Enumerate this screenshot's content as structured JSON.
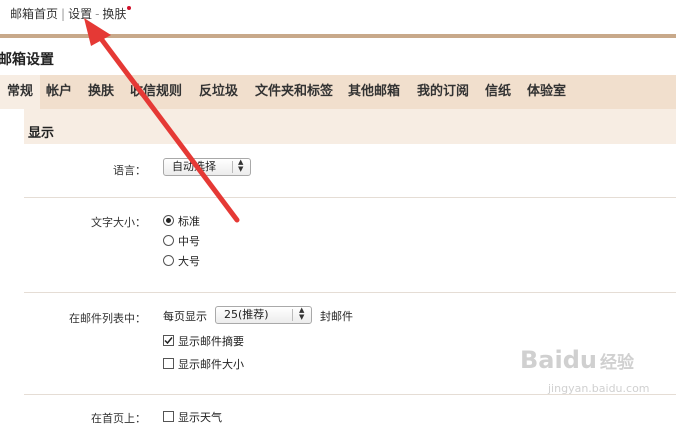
{
  "topnav": {
    "home": "邮箱首页",
    "sep": "|",
    "settings": "设置",
    "dash": "-",
    "skin": "换肤"
  },
  "page_title": "邮箱设置",
  "tabs": [
    {
      "label": "常规",
      "active": true
    },
    {
      "label": "帐户"
    },
    {
      "label": "换肤"
    },
    {
      "label": "收信规则"
    },
    {
      "label": "反垃圾"
    },
    {
      "label": "文件夹和标签"
    },
    {
      "label": "其他邮箱"
    },
    {
      "label": "我的订阅"
    },
    {
      "label": "信纸"
    },
    {
      "label": "体验室"
    }
  ],
  "section_title": "显示",
  "language": {
    "label": "语言：",
    "value": "自动选择"
  },
  "font_size": {
    "label": "文字大小：",
    "options": [
      "标准",
      "中号",
      "大号"
    ],
    "selected": "标准"
  },
  "mail_list": {
    "label": "在邮件列表中：",
    "per_page_prefix": "每页显示",
    "per_page_value": "25(推荐)",
    "per_page_suffix": "封邮件",
    "show_summary": "显示邮件摘要",
    "show_size": "显示邮件大小",
    "show_summary_checked": true,
    "show_size_checked": false
  },
  "homepage": {
    "label": "在首页上：",
    "show_weather": "显示天气"
  },
  "accent_color": "#d0102a",
  "watermark": {
    "brand": "Bai",
    "paw": "du",
    "cn": "经验",
    "url": "jingyan.baidu.com"
  }
}
